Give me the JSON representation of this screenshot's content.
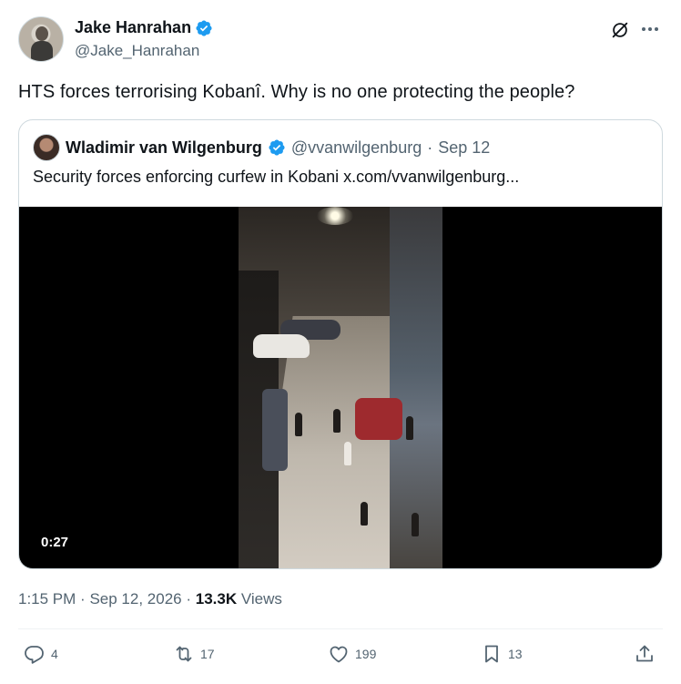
{
  "author": {
    "display_name": "Jake Hanrahan",
    "handle": "@Jake_Hanrahan",
    "verified_icon": "verified-badge-icon",
    "avatar": "avatar"
  },
  "header_icons": [
    "grok-icon",
    "more-icon"
  ],
  "tweet": {
    "text": "HTS forces terrorising Kobanî. Why is no one protecting the people?"
  },
  "quoted": {
    "display_name": "Wladimir van Wilgenburg",
    "handle": "@vvanwilgenburg",
    "separator": "·",
    "date": "Sep 12",
    "text": "Security forces enforcing curfew in Kobani  x.com/vvanwilgenburg...",
    "video": {
      "duration": "0:27"
    }
  },
  "meta": {
    "time": "1:15 PM",
    "separator1": "·",
    "date": "Sep 12, 2026",
    "separator2": "·",
    "views_count": "13.3K",
    "views_label": "Views"
  },
  "actions": {
    "replies": "4",
    "reposts": "17",
    "likes": "199",
    "bookmarks": "13"
  },
  "colors": {
    "text_primary": "#0f1419",
    "text_secondary": "#536471",
    "verified_blue": "#1d9bf0",
    "border": "#cfd9de"
  }
}
